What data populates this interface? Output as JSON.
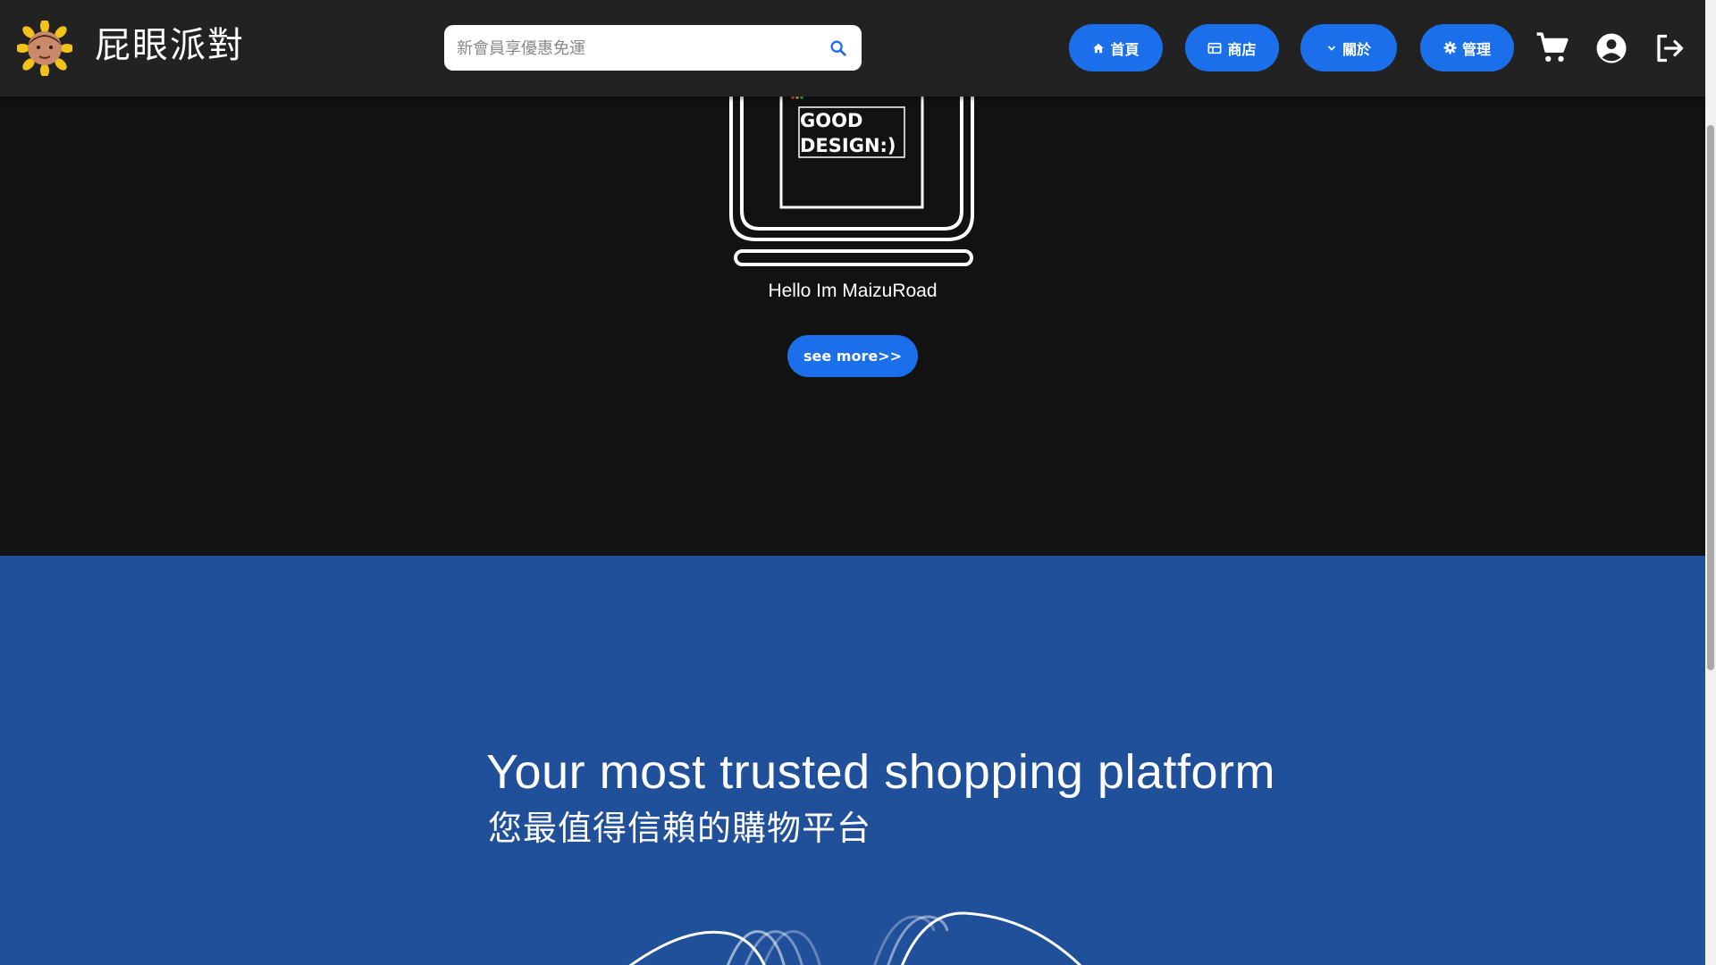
{
  "header": {
    "brand_name": "屁眼派對",
    "logo_icon": "sunflower-avatar-logo",
    "search": {
      "placeholder": "新會員享優惠免運",
      "value": "",
      "icon": "search-icon"
    },
    "nav": {
      "home_label": "首頁",
      "shop_label": "商店",
      "about_label": "關於",
      "admin_label": "管理"
    },
    "icons": [
      "cart-icon",
      "account-icon",
      "logout-icon"
    ]
  },
  "hero": {
    "laptop_screen_text_line1": "GOOD",
    "laptop_screen_text_line2": "DESIGN:)",
    "greeting": "Hello Im MaizuRoad",
    "see_more_label": "see more>>"
  },
  "trust_section": {
    "title_en": "Your most trusted shopping platform",
    "title_zh": "您最值得信賴的購物平台"
  },
  "colors": {
    "accent": "#1c6fea",
    "header_bg": "#222222",
    "hero_bg": "#121212",
    "section_bg": "#21509a"
  }
}
